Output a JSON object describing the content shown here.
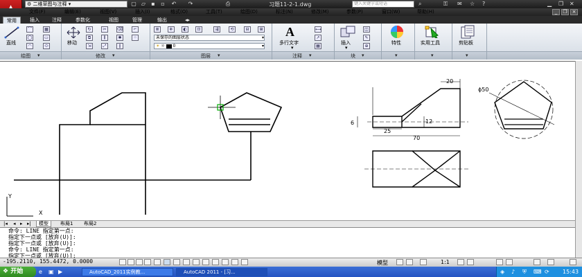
{
  "titlebar": {
    "workspace": "二维草图与注释",
    "title": "习题11-2-1.dwg",
    "search_placeholder": "键入关键字或短语"
  },
  "menubar": {
    "items": [
      "文件(F)",
      "编辑(E)",
      "视图(V)",
      "插入(I)",
      "格式(O)",
      "工具(T)",
      "绘图(D)",
      "标注(N)",
      "修改(M)",
      "参数(P)",
      "窗口(W)",
      "帮助(H)"
    ]
  },
  "ribbon": {
    "tabs": [
      "常用",
      "插入",
      "注释",
      "参数化",
      "视图",
      "管理",
      "输出"
    ],
    "active_tab": "常用",
    "panels": {
      "draw": "绘图",
      "modify": "修改",
      "layers": "图层",
      "annotation": "注释",
      "block": "块"
    },
    "buttons": {
      "line": "直线",
      "move": "移动",
      "mtext": "多行文字",
      "insert": "插入",
      "properties": "特性",
      "utilities": "实用工具",
      "clipboard": "剪贴板"
    },
    "layer_state": "未保存的图层状态",
    "layer_current": "0"
  },
  "drawing": {
    "dim_20": "20",
    "dim_6": "6",
    "dim_12": "12",
    "dim_25": "25",
    "dim_70": "70",
    "dim_phi50": "ϕ50",
    "ucs_y": "Y",
    "ucs_x": "X"
  },
  "layout_tabs": [
    "模型",
    "布局1",
    "布局2"
  ],
  "active_layout": "模型",
  "command": {
    "lines": [
      "命令:  LINE 指定第一点:",
      "指定下一点或 [放弃(U)]:",
      "指定下一点或 [放弃(U)]:",
      "命令:  LINE 指定第一点:",
      "指定下一点或 [放弃(U)]:"
    ]
  },
  "status": {
    "coords": "-195.2110, 155.4472, 0.0000",
    "model": "模型",
    "scale": "1:1"
  },
  "taskbar": {
    "start": "开始",
    "apps": [
      "AutoCAD_2011实例教...",
      "AutoCAD 2011 - [习..."
    ],
    "clock": "15:43"
  }
}
